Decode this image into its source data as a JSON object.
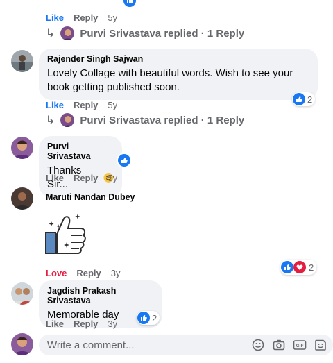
{
  "top_actions": {
    "like": "Like",
    "reply": "Reply",
    "time": "5y"
  },
  "replies_link_1": {
    "name": "Purvi Srivastava",
    "suffix": "replied",
    "count": "· 1 Reply"
  },
  "comments": [
    {
      "author": "Rajender Singh Sajwan",
      "text": "Lovely Collage with beautiful words. Wish to see your book getting published soon.",
      "like": "Like",
      "reply": "Reply",
      "time": "5y",
      "reaction_count": "2"
    },
    {
      "author": "Purvi Srivastava",
      "text": "Thanks Sir...",
      "like": "Like",
      "reply": "Reply",
      "time": "5y"
    },
    {
      "author": "Maruti Nandan Dubey",
      "like": "Love",
      "reply": "Reply",
      "time": "3y",
      "reaction_count": "2"
    },
    {
      "author": "Jagdish Prakash Srivastava",
      "text": "Memorable day",
      "like": "Like",
      "reply": "Reply",
      "time": "3y",
      "reaction_count": "2"
    }
  ],
  "replies_link_2": {
    "name": "Purvi Srivastava",
    "suffix": "replied",
    "count": "· 1 Reply"
  },
  "composer": {
    "placeholder": "Write a comment..."
  },
  "colors": {
    "accent": "#1877f2",
    "love": "#e41e3f",
    "bubble": "#f0f2f5",
    "muted": "#65676b"
  }
}
